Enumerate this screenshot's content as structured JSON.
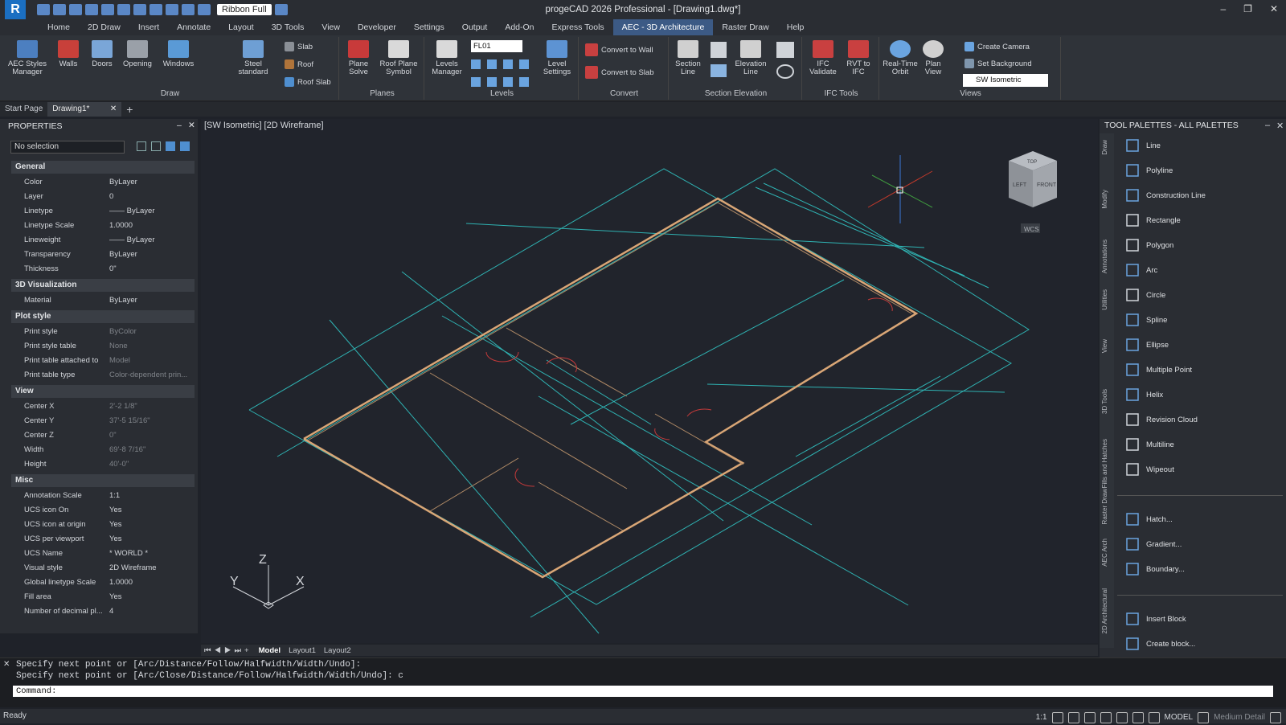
{
  "titlebar": {
    "app_title": "progeCAD 2026 Professional - [Drawing1.dwg*]",
    "ribbon_mode": "Ribbon Full",
    "controls": [
      "–",
      "❐",
      "✕"
    ]
  },
  "menu_tabs": [
    "Home",
    "2D Draw",
    "Insert",
    "Annotate",
    "Layout",
    "3D Tools",
    "View",
    "Developer",
    "Settings",
    "Output",
    "Add-On",
    "Express Tools",
    "AEC - 3D Architecture",
    "Raster Draw",
    "Help"
  ],
  "active_tab": "AEC - 3D Architecture",
  "ribbon": {
    "draw": {
      "title": "Draw",
      "aec_styles": "AEC Styles Manager",
      "walls": "Walls",
      "doors": "Doors",
      "opening": "Opening",
      "windows": "Windows",
      "steel": "Steel standard",
      "slab": "Slab",
      "roof": "Roof",
      "roof_slab": "Roof Slab"
    },
    "planes": {
      "title": "Planes",
      "plane_solve": "Plane Solve",
      "roof_plane_symbol": "Roof Plane Symbol"
    },
    "levels": {
      "title": "Levels",
      "levels_manager": "Levels Manager",
      "level_value": "FL01",
      "level_settings": "Level Settings"
    },
    "convert": {
      "title": "Convert",
      "to_wall": "Convert to Wall",
      "to_slab": "Convert to Slab"
    },
    "section": {
      "title": "Section Elevation",
      "section_line": "Section Line",
      "elevation_line": "Elevation Line"
    },
    "ifc": {
      "title": "IFC Tools",
      "ifc_validate": "IFC Validate",
      "rvt_to_ifc": "RVT to IFC"
    },
    "views": {
      "title": "Views",
      "orbit": "Real-Time Orbit",
      "plan_view": "Plan View",
      "create_camera": "Create Camera",
      "set_background": "Set Background",
      "view_select": "SW Isometric"
    }
  },
  "doc_tabs": {
    "start": "Start Page",
    "drawing": "Drawing1*",
    "close": "✕",
    "add": "+"
  },
  "properties": {
    "title": "PROPERTIES",
    "selection": "No selection",
    "sections": [
      {
        "name": "General",
        "rows": [
          [
            "Color",
            "ByLayer"
          ],
          [
            "Layer",
            "0"
          ],
          [
            "Linetype",
            "—— ByLayer"
          ],
          [
            "Linetype Scale",
            "1.0000"
          ],
          [
            "Lineweight",
            "—— ByLayer"
          ],
          [
            "Transparency",
            "ByLayer"
          ],
          [
            "Thickness",
            "0\""
          ]
        ]
      },
      {
        "name": "3D Visualization",
        "rows": [
          [
            "Material",
            "ByLayer"
          ]
        ]
      },
      {
        "name": "Plot style",
        "rows": [
          [
            "Print style",
            "ByColor"
          ],
          [
            "Print style table",
            "None"
          ],
          [
            "Print table attached to",
            "Model"
          ],
          [
            "Print table type",
            "Color-dependent prin..."
          ]
        ]
      },
      {
        "name": "View",
        "rows": [
          [
            "Center X",
            "2'-2 1/8\""
          ],
          [
            "Center Y",
            "37'-5 15/16\""
          ],
          [
            "Center Z",
            "0\""
          ],
          [
            "Width",
            "69'-8 7/16\""
          ],
          [
            "Height",
            "40'-0\""
          ]
        ]
      },
      {
        "name": "Misc",
        "rows": [
          [
            "Annotation Scale",
            "1:1"
          ],
          [
            "UCS icon On",
            "Yes"
          ],
          [
            "UCS icon at origin",
            "Yes"
          ],
          [
            "UCS per viewport",
            "Yes"
          ],
          [
            "UCS Name",
            "* WORLD *"
          ],
          [
            "Visual style",
            "2D Wireframe"
          ],
          [
            "Global linetype Scale",
            "1.0000"
          ],
          [
            "Fill area",
            "Yes"
          ],
          [
            "Number of decimal pl...",
            "4"
          ]
        ]
      }
    ]
  },
  "viewport": {
    "label": "[SW Isometric] [2D Wireframe]",
    "wcs": "WCS",
    "cube_left": "LEFT",
    "cube_front": "FRONT",
    "cube_top": "TOP",
    "axis_x": "X",
    "axis_y": "Y",
    "axis_z": "Z"
  },
  "layout_tabs": {
    "model": "Model",
    "layout1": "Layout1",
    "layout2": "Layout2"
  },
  "palette": {
    "title": "TOOL PALETTES - ALL PALETTES",
    "vtabs": [
      "Draw",
      "Modify",
      "Annotations",
      "Utilities",
      "View",
      "3D Tools",
      "Fills and Hatches",
      "Raster Draw",
      "AEC Arch",
      "2D Architectural"
    ],
    "tools1": [
      "Line",
      "Polyline",
      "Construction Line",
      "Rectangle",
      "Polygon",
      "Arc",
      "Circle",
      "Spline",
      "Ellipse",
      "Multiple Point",
      "Helix",
      "Revision Cloud",
      "Multiline",
      "Wipeout"
    ],
    "tools2": [
      "Hatch...",
      "Gradient...",
      "Boundary..."
    ],
    "tools3": [
      "Insert Block",
      "Create block..."
    ]
  },
  "command": {
    "line1": "Specify next point or [Arc/Distance/Follow/Halfwidth/Width/Undo]:",
    "line2": "Specify next point or [Arc/Close/Distance/Follow/Halfwidth/Width/Undo]: c",
    "prompt": "Command:"
  },
  "status": {
    "ready": "Ready",
    "scale": "1:1",
    "model": "MODEL",
    "detail": "Medium Detail"
  }
}
